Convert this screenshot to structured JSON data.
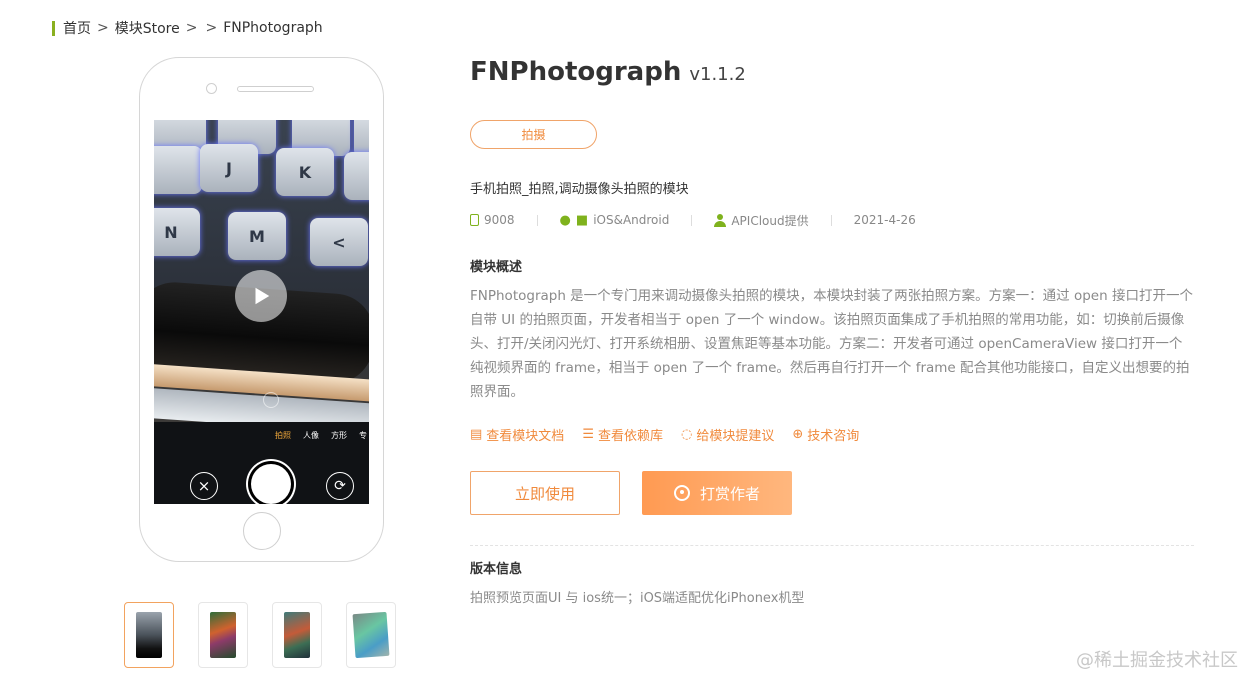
{
  "breadcrumb": {
    "home": "首页",
    "store": "模块Store",
    "current": "FNPhotograph",
    "separator": ">"
  },
  "phone_preview": {
    "keys": [
      "J",
      "K",
      "N",
      "M",
      "<"
    ],
    "camera_modes": [
      "拍照",
      "人像",
      "方形",
      "专"
    ],
    "active_mode": "拍照"
  },
  "module": {
    "name": "FNPhotograph",
    "version": "v1.1.2",
    "tag": "拍摄",
    "short_desc": "手机拍照_拍照,调动摄像头拍照的模块",
    "meta": {
      "downloads": "9008",
      "platforms": "iOS&Android",
      "provider": "APICloud提供",
      "date": "2021-4-26"
    }
  },
  "overview": {
    "heading": "模块概述",
    "text": "FNPhotograph 是一个专门用来调动摄像头拍照的模块，本模块封装了两张拍照方案。方案一：通过 open 接口打开一个自带 UI 的拍照页面，开发者相当于 open 了一个 window。该拍照页面集成了手机拍照的常用功能，如：切换前后摄像头、打开/关闭闪光灯、打开系统相册、设置焦距等基本功能。方案二：开发者可通过 openCameraView 接口打开一个纯视频界面的 frame，相当于 open 了一个 frame。然后再自行打开一个 frame 配合其他功能接口，自定义出想要的拍照界面。"
  },
  "links": {
    "docs": "查看模块文档",
    "deps": "查看依赖库",
    "suggest": "给模块提建议",
    "consult": "技术咨询"
  },
  "actions": {
    "use": "立即使用",
    "tip": "打赏作者"
  },
  "version_info": {
    "heading": "版本信息",
    "text": "拍照预览页面UI 与 ios统一；iOS端适配优化iPhonex机型"
  },
  "watermark": "@稀土掘金技术社区",
  "colors": {
    "accent": "#f08a3c",
    "brand_green": "#7fb21d",
    "breadcrumb_bar": "#8ab020"
  }
}
